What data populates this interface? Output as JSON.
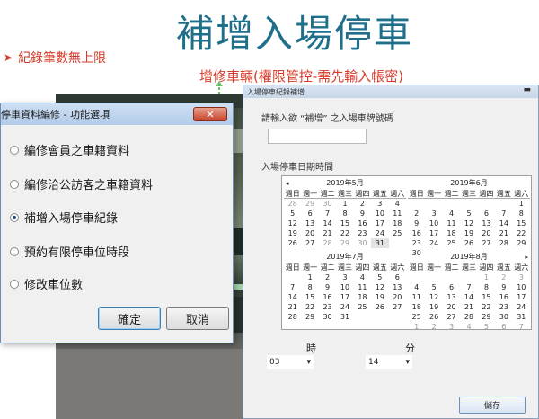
{
  "slide": {
    "title": "補增入場停車",
    "bullet": "紀錄筆數無上限",
    "annotation": "增修車輛(權限管控-需先輸入帳密)"
  },
  "options_dialog": {
    "title": "停車資料編修 - 功能選項",
    "close_label": "✕",
    "options": [
      {
        "label": "編修會員之車籍資料",
        "selected": false
      },
      {
        "label": "編修洽公訪客之車籍資料",
        "selected": false
      },
      {
        "label": "補增入場停車紀錄",
        "selected": true
      },
      {
        "label": "預約有限停車位時段",
        "selected": false
      },
      {
        "label": "修改車位數",
        "selected": false
      }
    ],
    "ok_label": "確定",
    "cancel_label": "取消"
  },
  "record_dialog": {
    "title": "入場停車紀錄補增",
    "plate_label": "請輸入欲 “補增” 之入場車牌號碼",
    "plate_value": "",
    "datetime_label": "入場停車日期時間",
    "hour_label": "時",
    "minute_label": "分",
    "hour_value": "03",
    "minute_value": "14",
    "save_label": "儲存",
    "calendar": {
      "weekday_headers": [
        "週日",
        "週一",
        "週二",
        "週三",
        "週四",
        "週五",
        "週六"
      ],
      "months": [
        {
          "title": "2019年5月",
          "nav_prev": "◂",
          "nav_next": "",
          "rows": [
            [
              "28",
              "29",
              "30",
              "1",
              "2",
              "3",
              "4"
            ],
            [
              "5",
              "6",
              "7",
              "8",
              "9",
              "10",
              "11"
            ],
            [
              "12",
              "13",
              "14",
              "15",
              "16",
              "17",
              "18"
            ],
            [
              "19",
              "20",
              "21",
              "22",
              "23",
              "24",
              "25"
            ],
            [
              "26",
              "27",
              "28",
              "29",
              "30",
              "31",
              ""
            ]
          ],
          "other_month": [
            "28",
            "29",
            "30"
          ],
          "selected": "31"
        },
        {
          "title": "2019年6月",
          "nav_prev": "",
          "nav_next": "",
          "rows": [
            [
              "",
              "",
              "",
              "",
              "",
              "",
              "1"
            ],
            [
              "2",
              "3",
              "4",
              "5",
              "6",
              "7",
              "8"
            ],
            [
              "9",
              "10",
              "11",
              "12",
              "13",
              "14",
              "15"
            ],
            [
              "16",
              "17",
              "18",
              "19",
              "20",
              "21",
              "22"
            ],
            [
              "23",
              "24",
              "25",
              "26",
              "27",
              "28",
              "29"
            ],
            [
              "30",
              "",
              "",
              "",
              "",
              "",
              ""
            ]
          ],
          "other_month": [],
          "selected": ""
        },
        {
          "title": "2019年7月",
          "nav_prev": "",
          "nav_next": "",
          "rows": [
            [
              "",
              "1",
              "2",
              "3",
              "4",
              "5",
              "6"
            ],
            [
              "7",
              "8",
              "9",
              "10",
              "11",
              "12",
              "13"
            ],
            [
              "14",
              "15",
              "16",
              "17",
              "18",
              "19",
              "20"
            ],
            [
              "21",
              "22",
              "23",
              "24",
              "25",
              "26",
              "27"
            ],
            [
              "28",
              "29",
              "30",
              "31",
              "",
              "",
              ""
            ]
          ],
          "other_month": [],
          "selected": ""
        },
        {
          "title": "2019年8月",
          "nav_prev": "",
          "nav_next": "▸",
          "rows": [
            [
              "",
              "",
              "",
              "",
              "1",
              "2",
              "3"
            ],
            [
              "4",
              "5",
              "6",
              "7",
              "8",
              "9",
              "10"
            ],
            [
              "11",
              "12",
              "13",
              "14",
              "15",
              "16",
              "17"
            ],
            [
              "18",
              "19",
              "20",
              "21",
              "22",
              "23",
              "24"
            ],
            [
              "25",
              "26",
              "27",
              "28",
              "29",
              "30",
              "31"
            ],
            [
              "1",
              "2",
              "3",
              "4",
              "5",
              "6",
              "7"
            ]
          ],
          "other_month": [
            "1",
            "2",
            "3",
            "4",
            "5",
            "6",
            "7"
          ],
          "selected": ""
        }
      ]
    }
  }
}
